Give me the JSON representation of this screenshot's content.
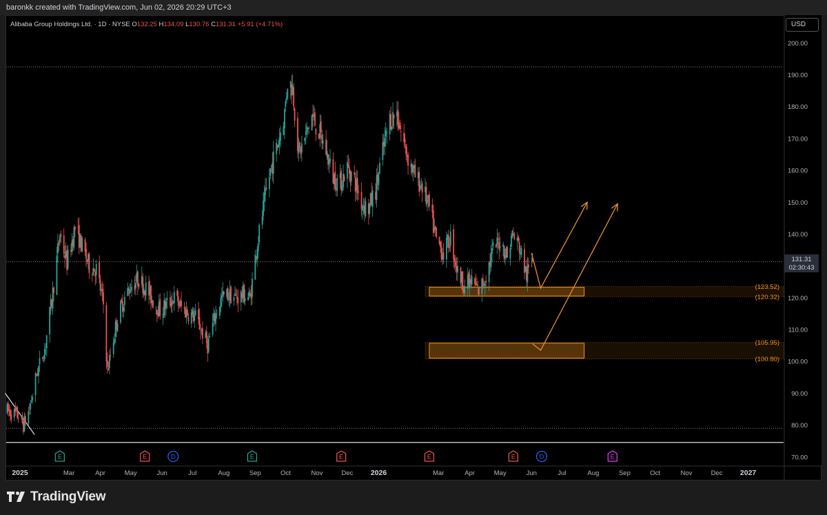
{
  "header": {
    "attribution": "baronkk created with TradingView.com, Jun 02, 2026 20:29 UTC+3"
  },
  "symbol": {
    "name": "Alibaba Group Holdings Ltd.",
    "interval": "1D",
    "exchange": "NYSE",
    "o_label": "O",
    "o": "132.25",
    "h_label": "H",
    "h": "134.09",
    "l_label": "L",
    "l": "130.76",
    "c_label": "C",
    "c": "131.31",
    "change": "+5.91 (+4.71%)"
  },
  "currency_button": "USD",
  "price_label": {
    "price": "131.31",
    "countdown": "02:30:43"
  },
  "footer": {
    "brand": "TradingView"
  },
  "colors": {
    "up": "#26a69a",
    "down": "#ef5350",
    "zone": "#f7931a",
    "event_green": "#26a69a",
    "event_red": "#ef5350",
    "event_blue": "#2962ff",
    "event_purple": "#e040fb"
  },
  "chart_data": {
    "type": "candlestick",
    "title": "Alibaba Group Holdings Ltd. · 1D · NYSE",
    "yaxis": {
      "ticks": [
        70,
        80,
        90,
        100,
        110,
        120,
        130,
        140,
        150,
        160,
        170,
        180,
        190,
        200
      ],
      "tick_labels": [
        "70.00",
        "80.00",
        "90.00",
        "100.00",
        "110.00",
        "120.00",
        "130.00",
        "140.00",
        "150.00",
        "160.00",
        "170.00",
        "180.00",
        "190.00",
        "200.00"
      ],
      "ylim": [
        68,
        207
      ]
    },
    "xaxis": {
      "labels": [
        "2025",
        "Mar",
        "Apr",
        "May",
        "Jun",
        "Jul",
        "Aug",
        "Sep",
        "Oct",
        "Nov",
        "Dec",
        "2026",
        "Mar",
        "Apr",
        "May",
        "Jun",
        "Jul",
        "Aug",
        "Sep",
        "Oct",
        "Nov",
        "Dec",
        "2027"
      ],
      "label_dates": [
        "2025-01-01",
        "2025-03-01",
        "2025-04-01",
        "2025-05-01",
        "2025-06-01",
        "2025-07-01",
        "2025-08-01",
        "2025-09-01",
        "2025-10-01",
        "2025-11-01",
        "2025-12-01",
        "2026-01-01",
        "2026-03-01",
        "2026-04-01",
        "2026-05-01",
        "2026-06-01",
        "2026-07-01",
        "2026-08-01",
        "2026-09-01",
        "2026-10-01",
        "2026-11-01",
        "2026-12-01",
        "2027-01-01"
      ],
      "bold_labels": [
        "2025",
        "2026",
        "2027"
      ],
      "range": [
        "2024-12-29",
        "2027-02-05"
      ]
    },
    "price_path": [
      [
        "2024-12-30",
        84.5
      ],
      [
        "2025-01-10",
        83
      ],
      [
        "2025-01-15",
        80
      ],
      [
        "2025-01-21",
        85
      ],
      [
        "2025-01-28",
        96
      ],
      [
        "2025-02-05",
        104
      ],
      [
        "2025-02-12",
        119
      ],
      [
        "2025-02-20",
        140
      ],
      [
        "2025-02-27",
        131
      ],
      [
        "2025-03-07",
        142
      ],
      [
        "2025-03-14",
        136
      ],
      [
        "2025-03-21",
        130
      ],
      [
        "2025-03-28",
        129
      ],
      [
        "2025-04-04",
        118
      ],
      [
        "2025-04-08",
        97
      ],
      [
        "2025-04-11",
        102
      ],
      [
        "2025-04-18",
        114
      ],
      [
        "2025-04-25",
        120
      ],
      [
        "2025-05-02",
        124
      ],
      [
        "2025-05-09",
        126
      ],
      [
        "2025-05-16",
        123
      ],
      [
        "2025-05-23",
        119
      ],
      [
        "2025-05-30",
        116
      ],
      [
        "2025-06-06",
        118
      ],
      [
        "2025-06-13",
        120
      ],
      [
        "2025-06-20",
        117
      ],
      [
        "2025-06-27",
        115
      ],
      [
        "2025-07-04",
        114
      ],
      [
        "2025-07-11",
        109
      ],
      [
        "2025-07-16",
        105
      ],
      [
        "2025-07-23",
        114
      ],
      [
        "2025-07-30",
        120
      ],
      [
        "2025-08-06",
        121
      ],
      [
        "2025-08-13",
        120
      ],
      [
        "2025-08-20",
        121
      ],
      [
        "2025-08-27",
        120
      ],
      [
        "2025-09-02",
        135
      ],
      [
        "2025-09-09",
        148
      ],
      [
        "2025-09-16",
        160
      ],
      [
        "2025-09-23",
        168
      ],
      [
        "2025-09-30",
        178
      ],
      [
        "2025-10-03",
        188
      ],
      [
        "2025-10-08",
        186
      ],
      [
        "2025-10-14",
        165
      ],
      [
        "2025-10-20",
        170
      ],
      [
        "2025-10-27",
        177
      ],
      [
        "2025-11-03",
        172
      ],
      [
        "2025-11-10",
        166
      ],
      [
        "2025-11-17",
        158
      ],
      [
        "2025-11-24",
        156
      ],
      [
        "2025-12-01",
        161
      ],
      [
        "2025-12-08",
        157
      ],
      [
        "2025-12-15",
        150
      ],
      [
        "2025-12-22",
        148
      ],
      [
        "2025-12-29",
        154
      ],
      [
        "2026-01-05",
        166
      ],
      [
        "2026-01-12",
        176
      ],
      [
        "2026-01-19",
        178
      ],
      [
        "2026-01-23",
        172
      ],
      [
        "2026-01-30",
        164
      ],
      [
        "2026-02-06",
        158
      ],
      [
        "2026-02-13",
        155
      ],
      [
        "2026-02-20",
        148
      ],
      [
        "2026-02-27",
        138
      ],
      [
        "2026-03-06",
        134
      ],
      [
        "2026-03-13",
        139
      ],
      [
        "2026-03-20",
        128
      ],
      [
        "2026-03-27",
        124
      ],
      [
        "2026-04-03",
        125
      ],
      [
        "2026-04-10",
        122
      ],
      [
        "2026-04-17",
        127
      ],
      [
        "2026-04-24",
        135
      ],
      [
        "2026-05-01",
        138
      ],
      [
        "2026-05-08",
        133
      ],
      [
        "2026-05-13",
        140
      ],
      [
        "2026-05-20",
        136
      ],
      [
        "2026-05-27",
        127
      ],
      [
        "2026-06-02",
        131
      ]
    ],
    "last": {
      "open": 132.25,
      "high": 134.09,
      "low": 130.76,
      "close": 131.31
    },
    "annotations": {
      "zones": [
        {
          "label_top": "(123.52)",
          "label_bottom": "(120.32)",
          "top": 123.52,
          "bottom": 120.32,
          "from": "2026-02-20",
          "to": "2026-07-23"
        },
        {
          "label_top": "(105.95)",
          "label_bottom": "(100.80)",
          "top": 105.95,
          "bottom": 100.8,
          "from": "2026-02-20",
          "to": "2026-07-23"
        }
      ],
      "horizontal_lines": [
        {
          "value": 192.5,
          "style": "dotted"
        },
        {
          "value": 79,
          "style": "dotted"
        },
        {
          "value": 74.55,
          "label": "74.55",
          "style": "solid"
        },
        {
          "value": 131.31,
          "style": "dotted"
        }
      ],
      "paths": [
        {
          "points": [
            [
              "2026-06-01",
              134
            ],
            [
              "2026-06-10",
              123
            ],
            [
              "2026-07-26",
              150
            ]
          ]
        },
        {
          "points": [
            [
              "2026-06-02",
              105.5
            ],
            [
              "2026-06-10",
              103.5
            ],
            [
              "2026-08-25",
              149.5
            ]
          ]
        }
      ],
      "trendline": {
        "points": [
          [
            "2024-12-28",
            90
          ],
          [
            "2025-01-26",
            77
          ]
        ]
      }
    },
    "events": [
      {
        "glyph": "E",
        "kind": "earnings",
        "date": "2025-02-20",
        "color": "green"
      },
      {
        "glyph": "E",
        "kind": "earnings",
        "date": "2025-05-15",
        "color": "red"
      },
      {
        "glyph": "D",
        "kind": "dividend",
        "date": "2025-06-12",
        "color": "blue"
      },
      {
        "glyph": "E",
        "kind": "earnings",
        "date": "2025-08-29",
        "color": "green"
      },
      {
        "glyph": "E",
        "kind": "earnings",
        "date": "2025-11-25",
        "color": "red"
      },
      {
        "glyph": "E",
        "kind": "earnings",
        "date": "2026-02-20",
        "color": "red"
      },
      {
        "glyph": "E",
        "kind": "earnings",
        "date": "2026-05-14",
        "color": "red"
      },
      {
        "glyph": "D",
        "kind": "dividend",
        "date": "2026-06-11",
        "color": "blue"
      },
      {
        "glyph": "E",
        "kind": "earnings",
        "date": "2026-08-20",
        "color": "purple"
      }
    ],
    "grid": false,
    "legend": "top-left"
  }
}
